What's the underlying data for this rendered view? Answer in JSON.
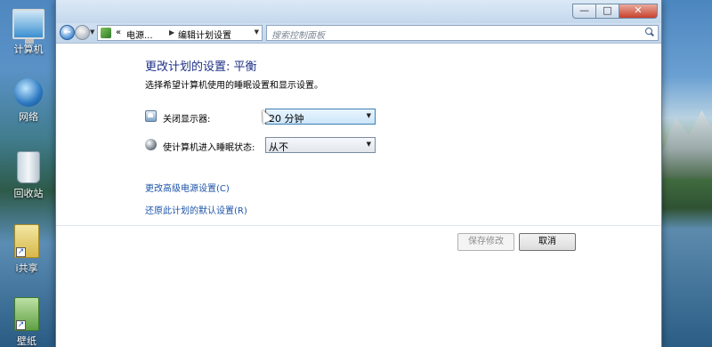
{
  "desktop": {
    "icons": [
      {
        "label": "计算机",
        "type": "computer-icon"
      },
      {
        "label": "网络",
        "type": "network-icon"
      },
      {
        "label": "回收站",
        "type": "recycle-bin-icon"
      },
      {
        "label": "i共享",
        "type": "folder-icon"
      },
      {
        "label": "壁纸",
        "type": "folder-icon"
      }
    ]
  },
  "window": {
    "controls": {
      "minimize": "—",
      "maximize": "□",
      "close": "✕"
    },
    "address": {
      "crumbs": [
        "电源...",
        "编辑计划设置"
      ],
      "overflow": "«"
    },
    "search": {
      "placeholder": "搜索控制面板"
    }
  },
  "content": {
    "title": "更改计划的设置: 平衡",
    "subtitle": "选择希望计算机使用的睡眠设置和显示设置。",
    "rows": [
      {
        "label": "关闭显示器:",
        "value": "20 分钟"
      },
      {
        "label": "使计算机进入睡眠状态:",
        "value": "从不"
      }
    ],
    "links": {
      "advanced": "更改高级电源设置(C)",
      "restore": "还原此计划的默认设置(R)"
    },
    "buttons": {
      "save": "保存修改",
      "cancel": "取消"
    }
  }
}
